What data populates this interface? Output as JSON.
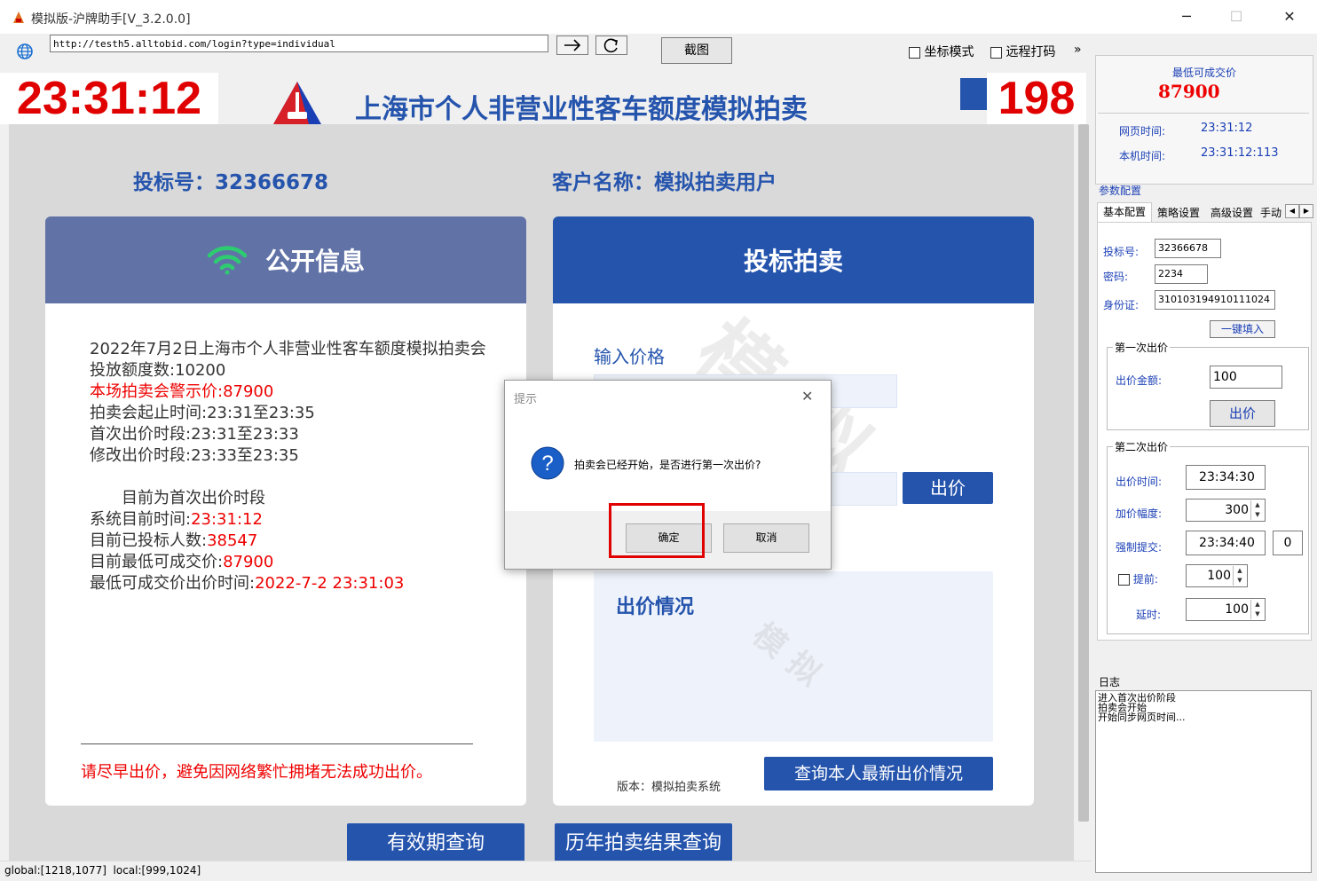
{
  "window": {
    "title": "模拟版-沪牌助手[V_3.2.0.0]",
    "minimize": "─",
    "maximize": "☐",
    "close": "✕"
  },
  "toolbar": {
    "url": "http://testh5.alltobid.com/login?type=individual",
    "go_icon": "arrow-right-icon",
    "refresh_icon": "refresh-icon",
    "screenshot_label": "截图",
    "coord_mode_label": "坐标模式",
    "remote_captcha_label": "远程打码",
    "more_label": "»"
  },
  "overlay": {
    "clock": "23:31:12",
    "countdown": "198"
  },
  "web": {
    "page_title": "上海市个人非营业性客车额度模拟拍卖",
    "bid_no_label": "投标号：",
    "bid_no": "32366678",
    "customer_label": "客户名称：",
    "customer_name": "模拟拍卖用户",
    "public_info": {
      "title": "公开信息",
      "lines": [
        "2022年7月2日上海市个人非营业性客车额度模拟拍卖会",
        "投放额度数:10200",
        "本场拍卖会警示价:87900",
        "拍卖会起止时间:23:31至23:35",
        "首次出价时段:23:31至23:33",
        "修改出价时段:23:33至23:35"
      ],
      "current_stage": "目前为首次出价时段",
      "sys_time_label": "系统目前时间:",
      "sys_time": "23:31:12",
      "bidders_label": "目前已投标人数:",
      "bidders": "38547",
      "lowest_price_label": "目前最低可成交价:",
      "lowest_price": "87900",
      "lowest_time_label": "最低可成交价出价时间:",
      "lowest_time": "2022-7-2 23:31:03",
      "warning": "请尽早出价，避免因网络繁忙拥堵无法成功出价。"
    },
    "bidding": {
      "title": "投标拍卖",
      "input_price_label": "输入价格",
      "bid_button": "出价",
      "status_title": "出价情况",
      "version": "版本：模拟拍卖系统",
      "query_latest_button": "查询本人最新出价情况"
    },
    "bottom_buttons": [
      "有效期查询",
      "历年拍卖结果查询"
    ],
    "watermark": "模拟"
  },
  "dialog": {
    "title": "提示",
    "message": "拍卖会已经开始，是否进行第一次出价?",
    "confirm": "确定",
    "cancel": "取消",
    "close": "✕"
  },
  "right_panel": {
    "lowest_price_label": "最低可成交价",
    "lowest_price": "87900",
    "web_time_label": "网页时间:",
    "web_time": "23:31:12",
    "local_time_label": "本机时间:",
    "local_time": "23:31:12:113",
    "params_label": "参数配置",
    "tabs": [
      "基本配置",
      "策略设置",
      "高级设置",
      "手动"
    ],
    "bid_no_label": "投标号:",
    "bid_no": "32366678",
    "password_label": "密码:",
    "password": "2234",
    "id_label": "身份证:",
    "id_number": "310103194910111024",
    "fill_button": "一键填入",
    "first_bid_title": "第一次出价",
    "first_amount_label": "出价金额:",
    "first_amount": "100",
    "first_bid_button": "出价",
    "second_bid_title": "第二次出价",
    "bid_time_label": "出价时间:",
    "bid_time": "23:34:30",
    "increment_label": "加价幅度:",
    "increment": "300",
    "force_submit_label": "强制提交:",
    "force_submit_time": "23:34:40",
    "force_submit_extra": "0",
    "advance_label": "提前:",
    "advance": "100",
    "delay_label": "延时:",
    "delay": "100",
    "log_label": "日志",
    "log_lines": [
      "进入首次出价阶段",
      "拍卖会开始",
      "开始同步网页时间..."
    ]
  },
  "statusbar": {
    "text": "global:[1218,1077]  local:[999,1024]"
  },
  "colors": {
    "public_header": "#6173a6",
    "bid_header": "#2554ad",
    "title_blue": "#2554ad",
    "clock_red": "#e00000",
    "highlight_box": "#e00000"
  }
}
